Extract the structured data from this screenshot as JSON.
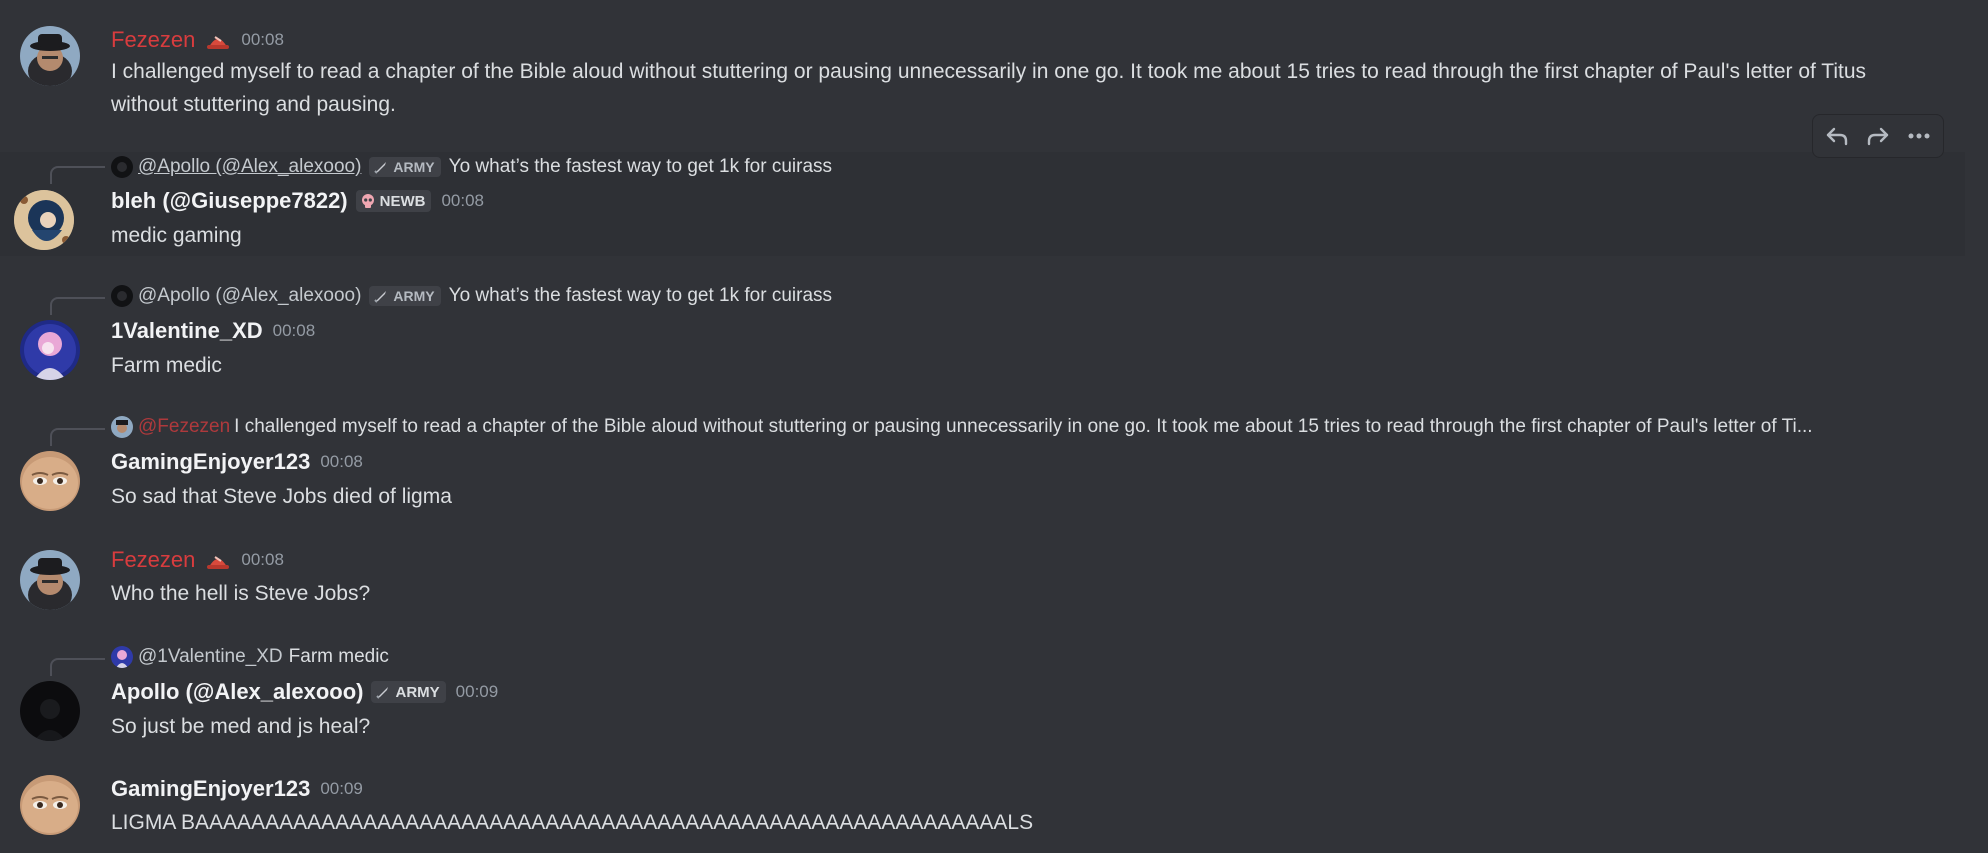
{
  "colors": {
    "background": "#313338",
    "hover_background": "#2e3035",
    "username_red": "#d83c3e",
    "text": "#dbdee1",
    "muted": "#949ba4"
  },
  "messages": [
    {
      "id": "m1",
      "username": "Fezezen",
      "username_color": "#d83c3e",
      "badge_icon": "red-hat-icon",
      "timestamp": "00:08",
      "content": "I challenged myself to read a chapter of the Bible aloud without stuttering or pausing unnecessarily in one go. It took me about 15 tries to read through the first chapter of Paul's letter of Titus without stuttering and pausing."
    },
    {
      "id": "m2",
      "reply": {
        "name": "@Apollo (@Alex_alexooo)",
        "tag": "ARMY",
        "tag_icon": "sword-icon",
        "text": "Yo what’s the fastest way to get 1k for cuirass"
      },
      "username": "bleh (@Giuseppe7822)",
      "tag": "NEWB",
      "tag_icon": "skull-icon",
      "timestamp": "00:08",
      "content": "medic gaming"
    },
    {
      "id": "m3",
      "reply": {
        "name": "@Apollo (@Alex_alexooo)",
        "tag": "ARMY",
        "tag_icon": "sword-icon",
        "text": "Yo what’s the fastest way to get 1k for cuirass"
      },
      "username": "1Valentine_XD",
      "timestamp": "00:08",
      "content": "Farm medic"
    },
    {
      "id": "m4",
      "reply": {
        "name": "@Fezezen",
        "text": "I challenged myself to read a chapter of the Bible aloud without stuttering or pausing unnecessarily in one go. It took me about 15 tries to read through the first chapter of Paul's letter of Ti..."
      },
      "username": "GamingEnjoyer123",
      "timestamp": "00:08",
      "content": "So sad that Steve Jobs died of ligma"
    },
    {
      "id": "m5",
      "username": "Fezezen",
      "username_color": "#d83c3e",
      "badge_icon": "red-hat-icon",
      "timestamp": "00:08",
      "content": "Who the hell is Steve Jobs?"
    },
    {
      "id": "m6",
      "reply": {
        "name": "@1Valentine_XD",
        "text": "Farm medic"
      },
      "username": "Apollo (@Alex_alexooo)",
      "tag": "ARMY",
      "tag_icon": "sword-icon",
      "timestamp": "00:09",
      "content": "So just be med and js heal?"
    },
    {
      "id": "m7",
      "username": "GamingEnjoyer123",
      "timestamp": "00:09",
      "content": "LIGMA BAAAAAAAAAAAAAAAAAAAAAAAAAAAAAAAAAAAAAAAAAAAAAAAAAAAAAAAAAALS"
    }
  ],
  "toolbar": {
    "actions": [
      "reply-icon",
      "forward-icon",
      "more-options-icon"
    ]
  }
}
